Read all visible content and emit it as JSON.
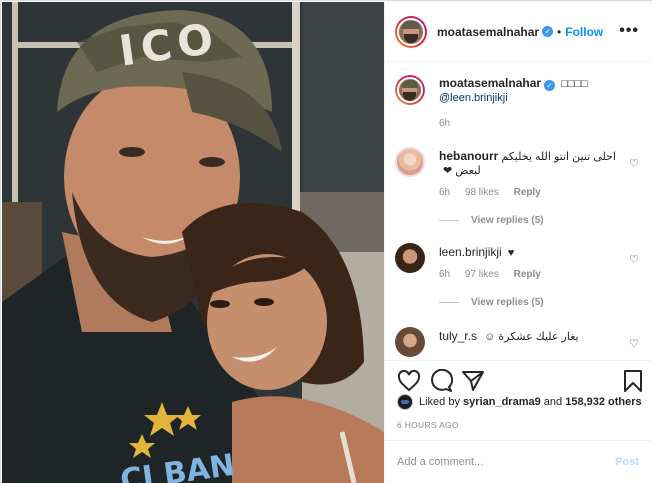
{
  "post": {
    "author": "moatasemalnahar",
    "follow_label": "Follow",
    "more_label": "•••",
    "caption_emoji": "□□□□",
    "caption_mention": "@leen.brinjikji",
    "caption_time": "6h"
  },
  "comments": [
    {
      "user": "hebanourr",
      "text": "احلى تنين انتو الله يخليكم لبعض ❤",
      "time": "6h",
      "likes": "98 likes",
      "reply": "Reply",
      "view_replies": "View replies (5)"
    },
    {
      "user": "leen.brinjikji",
      "text": "♥",
      "time": "6h",
      "likes": "97 likes",
      "reply": "Reply",
      "view_replies": "View replies (5)"
    },
    {
      "user": "tuly_r.s",
      "text": "يغار عليك عشكرة ☺"
    }
  ],
  "footer": {
    "liked_by_prefix": "Liked by",
    "liked_by_user": "syrian_drama9",
    "liked_by_suffix": "and",
    "liked_by_count": "158,932 others",
    "time_ago": "6 HOURS AGO",
    "comment_placeholder": "Add a comment...",
    "post_label": "Post"
  },
  "photo": {
    "cap_text": "ICO",
    "shirt_text": "CI BAN"
  },
  "colors": {
    "link_blue": "#0095f6",
    "verified_blue": "#3897f0",
    "muted": "#8e8e8e",
    "post_disabled": "#b2dffc"
  }
}
